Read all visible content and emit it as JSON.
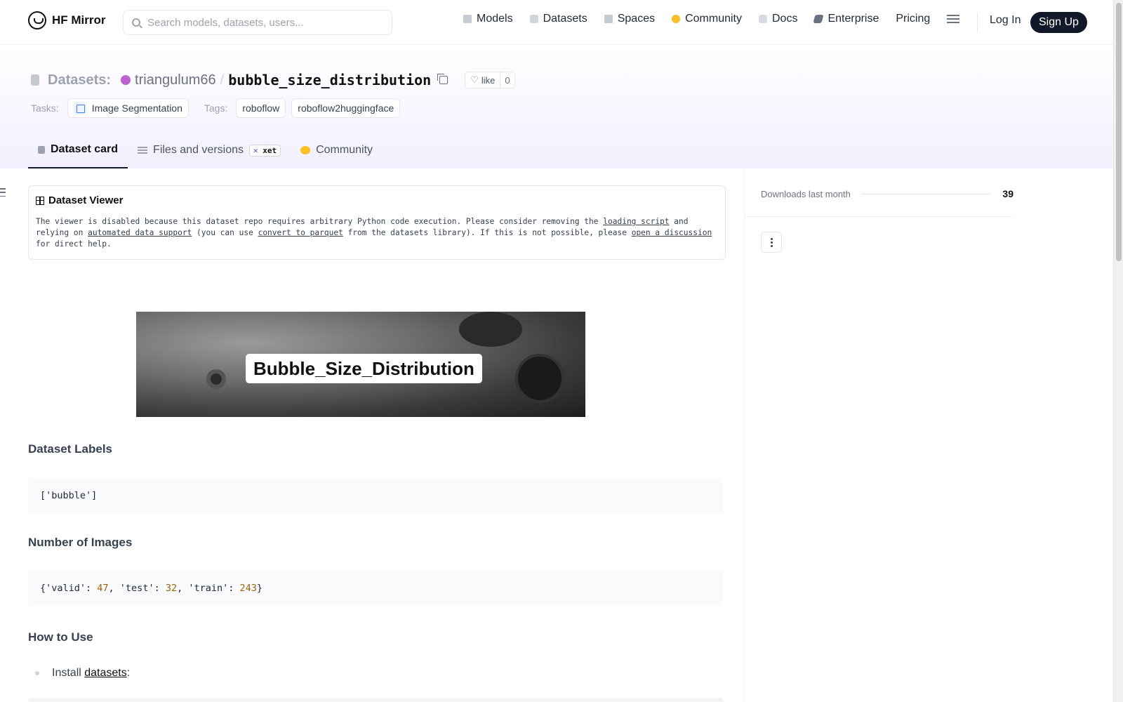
{
  "nav": {
    "brand": "HF Mirror",
    "search_placeholder": "Search models, datasets, users...",
    "links": [
      {
        "label": "Models",
        "icon": "cube-icon"
      },
      {
        "label": "Datasets",
        "icon": "database-icon"
      },
      {
        "label": "Spaces",
        "icon": "grid-icon"
      },
      {
        "label": "Community",
        "icon": "community-icon"
      },
      {
        "label": "Docs",
        "icon": "book-icon"
      },
      {
        "label": "Enterprise",
        "icon": "enterprise-icon"
      },
      {
        "label": "Pricing"
      }
    ],
    "login": "Log In",
    "signup": "Sign Up"
  },
  "repo": {
    "kind": "Datasets:",
    "owner": "triangulum66",
    "separator": "/",
    "name": "bubble_size_distribution",
    "like_label": "like",
    "like_count": "0",
    "tasks_label": "Tasks:",
    "task": "Image Segmentation",
    "tags_label": "Tags:",
    "tags": [
      "roboflow",
      "roboflow2huggingface"
    ]
  },
  "tabs": [
    {
      "label": "Dataset card",
      "active": true
    },
    {
      "label": "Files and versions",
      "badge": "xet"
    },
    {
      "label": "Community"
    }
  ],
  "viewer": {
    "title": "Dataset Viewer",
    "text_1": "The viewer is disabled because this dataset repo requires arbitrary Python code execution. Please consider removing the ",
    "link_1": "loading script",
    "text_2": " and relying on ",
    "link_2": "automated data support",
    "text_3": " (you can use ",
    "link_3": "convert to parquet",
    "text_4": " from the datasets library). If this is not possible, please ",
    "link_4": "open a discussion",
    "text_5": " for direct help."
  },
  "banner": {
    "label": "Bubble_Size_Distribution"
  },
  "sections": {
    "labels_heading": "Dataset Labels",
    "labels_code": "['bubble']",
    "images_heading": "Number of Images",
    "images_code": {
      "open": "{'valid': ",
      "valid": "47",
      "test_key": ", 'test': ",
      "test": "32",
      "train_key": ", 'train': ",
      "train": "243",
      "close": "}"
    },
    "howto_heading": "How to Use",
    "bullet_prefix": "Install ",
    "bullet_link": "datasets",
    "bullet_suffix": ":"
  },
  "sidebar": {
    "downloads_label": "Downloads last month",
    "downloads_value": "39"
  },
  "colors": {
    "accent": "#111827",
    "owner_dot": "#c060d0",
    "number": "#a16207"
  }
}
